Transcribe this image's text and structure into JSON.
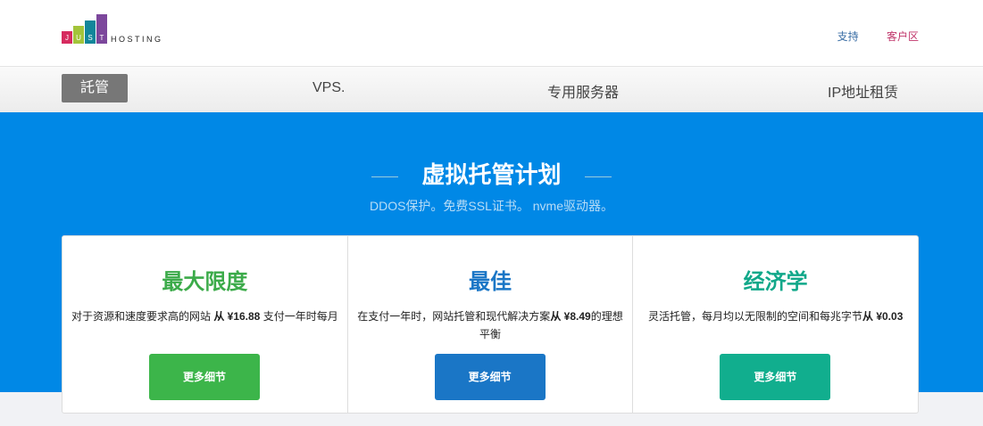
{
  "logo": {
    "letters": [
      "J",
      "U",
      "S",
      "T"
    ],
    "word": "HOSTING",
    "colors": [
      "#d62b5f",
      "#a3c43a",
      "#12869a",
      "#7c479c"
    ]
  },
  "toplinks": {
    "support": "支持",
    "client_area": "客户区"
  },
  "nav": [
    "託管",
    "VPS.",
    "专用服务器",
    "IP地址租赁"
  ],
  "hero": {
    "title": "虚拟托管计划",
    "subtitle": "DDOS保护。免费SSL证书。 nvme驱动器。"
  },
  "cards": [
    {
      "title": "最大限度",
      "desc": "对于资源和速度要求高的网站 ",
      "price": "从 ¥16.88",
      "desc2": " 支付一年时每月",
      "button": "更多细节",
      "color": "#3cb54a"
    },
    {
      "title": "最佳",
      "desc": "在支付一年时，网站托管和现代解决方案",
      "price": "从 ¥8.49",
      "desc2": "的理想平衡",
      "button": "更多细节",
      "color": "#1a76c6"
    },
    {
      "title": "经济学",
      "desc": "灵活托管，每月均以无限制的空间和每兆字节",
      "price": "从 ¥0.03",
      "desc2": "",
      "button": "更多细节",
      "color": "#11ae8e"
    }
  ]
}
